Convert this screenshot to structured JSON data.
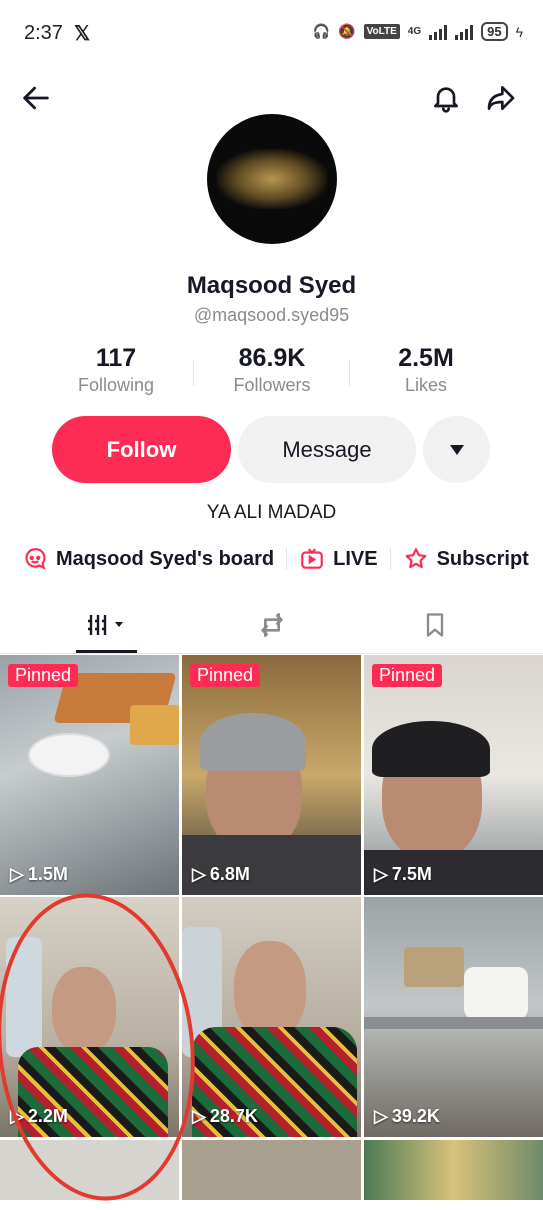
{
  "status_bar": {
    "time": "2:37",
    "network": "4G",
    "volte": "VoLTE",
    "battery": "95"
  },
  "profile": {
    "name": "Maqsood Syed",
    "handle": "@maqsood.syed95",
    "bio": "YA ALI MADAD"
  },
  "stats": [
    {
      "value": "117",
      "label": "Following"
    },
    {
      "value": "86.9K",
      "label": "Followers"
    },
    {
      "value": "2.5M",
      "label": "Likes"
    }
  ],
  "actions": {
    "follow": "Follow",
    "message": "Message"
  },
  "links": [
    {
      "label": "Maqsood Syed's board",
      "icon": "board-icon"
    },
    {
      "label": "LIVE",
      "icon": "live-icon"
    },
    {
      "label": "Subscript",
      "icon": "subscription-icon"
    }
  ],
  "tabs": [
    {
      "icon": "videos-grid-icon",
      "active": true
    },
    {
      "icon": "repost-icon",
      "active": false
    },
    {
      "icon": "bookmark-icon",
      "active": false
    }
  ],
  "videos": [
    {
      "pinned": "Pinned",
      "views": "1.5M"
    },
    {
      "pinned": "Pinned",
      "views": "6.8M"
    },
    {
      "pinned": "Pinned",
      "views": "7.5M"
    },
    {
      "pinned": "",
      "views": "2.2M"
    },
    {
      "pinned": "",
      "views": "28.7K"
    },
    {
      "pinned": "",
      "views": "39.2K"
    }
  ],
  "colors": {
    "accent": "#fe2c55",
    "annotation_circle": "#e13a2f",
    "secondary_text": "#8a8b91"
  }
}
